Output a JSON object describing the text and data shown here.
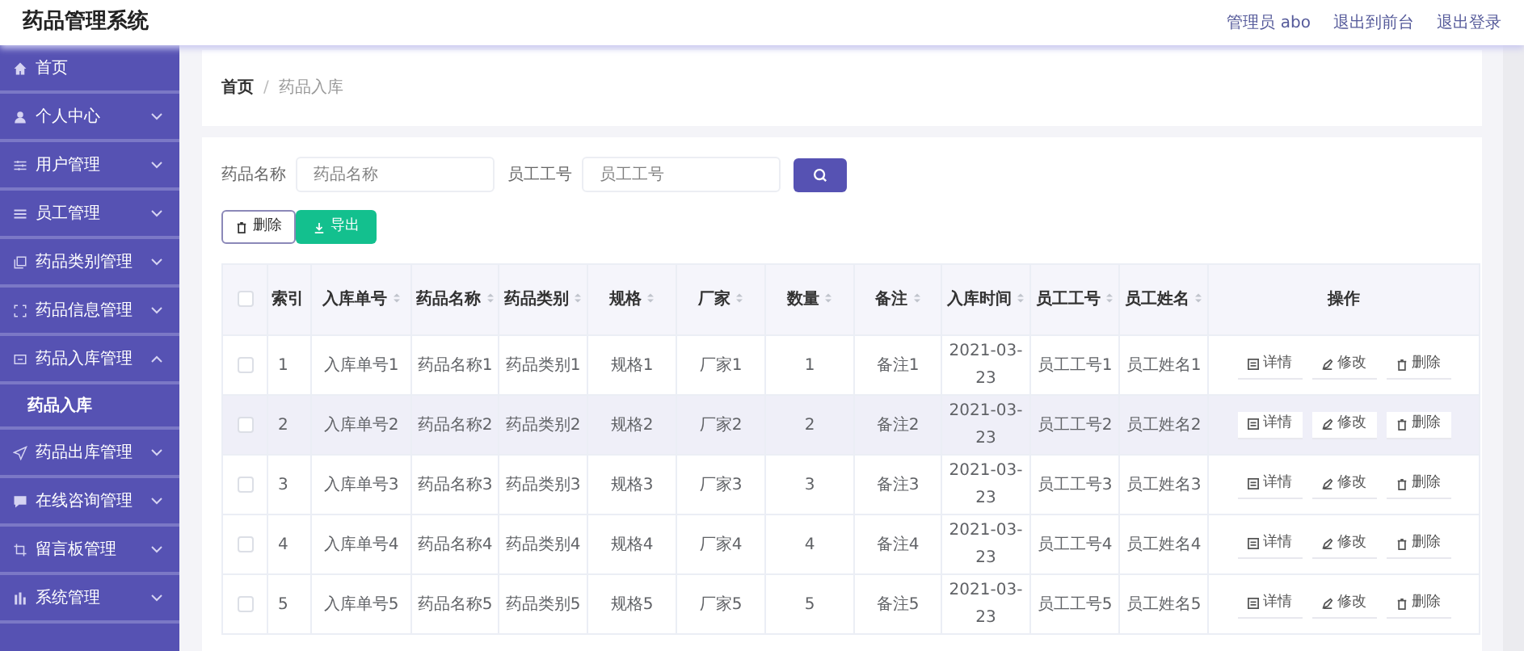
{
  "header": {
    "title": "药品管理系统",
    "links": [
      "管理员 abo",
      "退出到前台",
      "退出登录"
    ]
  },
  "sidebar": {
    "items": [
      {
        "label": "首页"
      },
      {
        "label": "个人中心",
        "expanded": false
      },
      {
        "label": "用户管理",
        "expanded": false
      },
      {
        "label": "员工管理",
        "expanded": false
      },
      {
        "label": "药品类别管理",
        "expanded": false
      },
      {
        "label": "药品信息管理",
        "expanded": false
      },
      {
        "label": "药品入库管理",
        "expanded": true,
        "children": [
          {
            "label": "药品入库",
            "selected": true
          }
        ]
      },
      {
        "label": "药品出库管理",
        "expanded": false
      },
      {
        "label": "在线咨询管理",
        "expanded": false
      },
      {
        "label": "留言板管理",
        "expanded": false
      },
      {
        "label": "系统管理",
        "expanded": false
      }
    ]
  },
  "breadcrumb": {
    "separator": "/",
    "items": [
      "首页",
      "药品入库"
    ]
  },
  "search": {
    "fields": [
      {
        "label": "药品名称",
        "placeholder": "药品名称"
      },
      {
        "label": "员工工号",
        "placeholder": "员工工号"
      }
    ]
  },
  "actions": [
    {
      "label": "删除",
      "kind": "delete"
    },
    {
      "label": "导出",
      "kind": "export"
    }
  ],
  "table": {
    "columns": [
      {
        "label": "索引",
        "sortable": false
      },
      {
        "label": "入库单号",
        "sortable": true
      },
      {
        "label": "药品名称",
        "sortable": true
      },
      {
        "label": "药品类别",
        "sortable": true
      },
      {
        "label": "规格",
        "sortable": true
      },
      {
        "label": "厂家",
        "sortable": true
      },
      {
        "label": "数量",
        "sortable": true
      },
      {
        "label": "备注",
        "sortable": true
      },
      {
        "label": "入库时间",
        "sortable": true
      },
      {
        "label": "员工工号",
        "sortable": true
      },
      {
        "label": "员工姓名",
        "sortable": true
      },
      {
        "label": "操作",
        "sortable": false
      }
    ],
    "header_checked": false,
    "rows": [
      {
        "checked": false,
        "hovered": false,
        "cells": [
          "1",
          "入库单号1",
          "药品名称1",
          "药品类别1",
          "规格1",
          "厂家1",
          "1",
          "备注1",
          "2021-03-23",
          "员工工号1",
          "员工姓名1"
        ],
        "actions": [
          "详情",
          "修改",
          "删除"
        ]
      },
      {
        "checked": false,
        "hovered": true,
        "cells": [
          "2",
          "入库单号2",
          "药品名称2",
          "药品类别2",
          "规格2",
          "厂家2",
          "2",
          "备注2",
          "2021-03-23",
          "员工工号2",
          "员工姓名2"
        ],
        "actions": [
          "详情",
          "修改",
          "删除"
        ]
      },
      {
        "checked": false,
        "hovered": false,
        "cells": [
          "3",
          "入库单号3",
          "药品名称3",
          "药品类别3",
          "规格3",
          "厂家3",
          "3",
          "备注3",
          "2021-03-23",
          "员工工号3",
          "员工姓名3"
        ],
        "actions": [
          "详情",
          "修改",
          "删除"
        ]
      },
      {
        "checked": false,
        "hovered": false,
        "cells": [
          "4",
          "入库单号4",
          "药品名称4",
          "药品类别4",
          "规格4",
          "厂家4",
          "4",
          "备注4",
          "2021-03-23",
          "员工工号4",
          "员工姓名4"
        ],
        "actions": [
          "详情",
          "修改",
          "删除"
        ]
      },
      {
        "checked": false,
        "hovered": false,
        "cells": [
          "5",
          "入库单号5",
          "药品名称5",
          "药品类别5",
          "规格5",
          "厂家5",
          "5",
          "备注5",
          "2021-03-23",
          "员工工号5",
          "员工姓名5"
        ],
        "actions": [
          "详情",
          "修改",
          "删除"
        ]
      }
    ]
  }
}
